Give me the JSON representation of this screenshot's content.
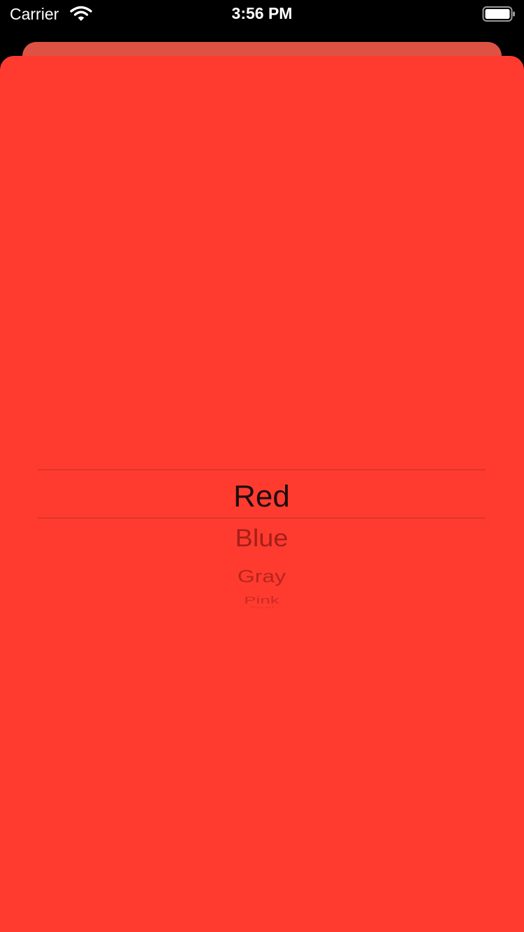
{
  "status_bar": {
    "carrier": "Carrier",
    "time": "3:56 PM",
    "wifi_icon": "wifi-icon",
    "battery_icon": "battery-full-icon"
  },
  "colors": {
    "sheet": "#ff3b30",
    "back_card": "#de5244",
    "status_bar": "#000000"
  },
  "picker": {
    "selected": "Red",
    "items": [
      "Red",
      "Blue",
      "Gray",
      "Pink",
      "Teal"
    ]
  }
}
